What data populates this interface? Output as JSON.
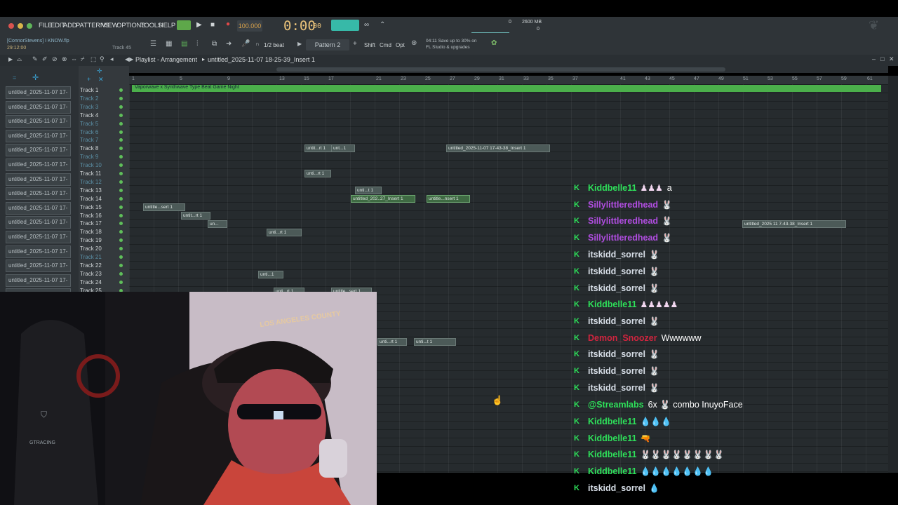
{
  "menu": [
    "FILE",
    "EDIT",
    "ADD",
    "PATTERNS",
    "VIEW",
    "OPTIONS",
    "TOOLS",
    "HELP"
  ],
  "transport": {
    "tempo": "100.000",
    "time": "0:00",
    "time_small": "00",
    "cpu_mem": "2600 MB",
    "cpu_a": "0",
    "cpu_b": "0"
  },
  "project": {
    "user": "[ConnorStevens] I KNOW.flp",
    "elapsed": "29:12:00",
    "track_label": "Track 45"
  },
  "toolbar": {
    "snap": "1/2 beat",
    "pattern": "Pattern 2",
    "shift": "Shift",
    "cmd": "Cmd",
    "opt": "Opt",
    "promo_line1": "04:11  Save up to 30% on",
    "promo_line2": "FL Studio & upgrades"
  },
  "playlist": {
    "title": "Playlist - Arrangement",
    "path": "untitled_2025-11-07 18-25-39_Insert 1"
  },
  "ruler": [
    "1",
    "5",
    "9",
    "13",
    "15",
    "17",
    "21",
    "23",
    "25",
    "27",
    "29",
    "31",
    "33",
    "35",
    "37",
    "41",
    "43",
    "45",
    "47",
    "49",
    "51",
    "53",
    "55",
    "57",
    "59",
    "61"
  ],
  "header_clip": "Vaporwave x Synthwave Type Beat Game Night",
  "browser_items": [
    "untitled_2025-11-07 17-",
    "untitled_2025-11-07 17-",
    "untitled_2025-11-07 17-",
    "untitled_2025-11-07 17-",
    "untitled_2025-11-07 17-",
    "untitled_2025-11-07 17-",
    "untitled_2025-11-07 17-",
    "untitled_2025-11-07 17-",
    "untitled_2025-11-07 17-",
    "untitled_2025-11-07 17-",
    "untitled_2025-11-07 17-",
    "untitled_2025-11-07 17-",
    "untitled_2025-11-07 17-",
    "untitled_2025-11-07 17-",
    "untitled_2025-11-07 17-"
  ],
  "tracks": [
    "Track 1",
    "Track 2",
    "Track 3",
    "Track 4",
    "Track 5",
    "Track 6",
    "Track 7",
    "Track 8",
    "Track 9",
    "Track 10",
    "Track 11",
    "Track 12",
    "Track 13",
    "Track 14",
    "Track 15",
    "Track 16",
    "Track 17",
    "Track 18",
    "Track 19",
    "Track 20",
    "Track 21",
    "Track 22",
    "Track 23",
    "Track 24",
    "Track 25"
  ],
  "clips": [
    {
      "label": "untit...rt 1"
    },
    {
      "label": "unt...1"
    },
    {
      "label": "untitled_2025-11-07 17-43-38_Insert 1"
    },
    {
      "label": "unti...rt 1"
    },
    {
      "label": "unti...t 1"
    },
    {
      "label": "untitled_202..27_Insert 1"
    },
    {
      "label": "untitle...nsert 1"
    },
    {
      "label": "untitle...sert 1"
    },
    {
      "label": "unti...rt 1"
    },
    {
      "label": "un..."
    },
    {
      "label": "unti...rt 1"
    },
    {
      "label": "unti...t 1"
    },
    {
      "label": "unti...1"
    },
    {
      "label": "untitle...sert 1"
    },
    {
      "label": "unti...rt 1"
    },
    {
      "label": "untit...rt 1"
    },
    {
      "label": "untitled_2025 11  7-43-38_Insert 1"
    }
  ],
  "chat": [
    {
      "user": "Kiddbelle11",
      "color": "#2ee05a",
      "msg": "a",
      "emotes": "♟♟♟"
    },
    {
      "user": "Sillylittleredhead",
      "color": "#b04de0",
      "msg": "",
      "emotes": "🐰"
    },
    {
      "user": "Sillylittleredhead",
      "color": "#b04de0",
      "msg": "",
      "emotes": "🐰"
    },
    {
      "user": "Sillylittleredhead",
      "color": "#b04de0",
      "msg": "",
      "emotes": "🐰"
    },
    {
      "user": "itskidd_sorrel",
      "color": "#d6dde6",
      "msg": "",
      "emotes": "🐰"
    },
    {
      "user": "itskidd_sorrel",
      "color": "#d6dde6",
      "msg": "",
      "emotes": "🐰"
    },
    {
      "user": "itskidd_sorrel",
      "color": "#d6dde6",
      "msg": "",
      "emotes": "🐰"
    },
    {
      "user": "Kiddbelle11",
      "color": "#2ee05a",
      "msg": "",
      "emotes": "♟♟♟♟♟"
    },
    {
      "user": "itskidd_sorrel",
      "color": "#d6dde6",
      "msg": "",
      "emotes": "🐰"
    },
    {
      "user": "Demon_Snoozer",
      "color": "#d0253f",
      "msg": "Wwwwww",
      "emotes": ""
    },
    {
      "user": "itskidd_sorrel",
      "color": "#d6dde6",
      "msg": "",
      "emotes": "🐰"
    },
    {
      "user": "itskidd_sorrel",
      "color": "#d6dde6",
      "msg": "",
      "emotes": "🐰"
    },
    {
      "user": "itskidd_sorrel",
      "color": "#d6dde6",
      "msg": "",
      "emotes": "🐰"
    },
    {
      "user": "@Streamlabs",
      "color": "#2ee05a",
      "msg": "6x 🐰 combo InuyoFace",
      "emotes": ""
    },
    {
      "user": "Kiddbelle11",
      "color": "#2ee05a",
      "msg": "",
      "emotes": "💧💧💧"
    },
    {
      "user": "Kiddbelle11",
      "color": "#2ee05a",
      "msg": "",
      "emotes": "🔫"
    },
    {
      "user": "Kiddbelle11",
      "color": "#2ee05a",
      "msg": "",
      "emotes": "🐰🐰🐰🐰🐰🐰🐰🐰"
    },
    {
      "user": "Kiddbelle11",
      "color": "#2ee05a",
      "msg": "",
      "emotes": "💧💧💧💧💧💧💧"
    },
    {
      "user": "itskidd_sorrel",
      "color": "#d6dde6",
      "msg": "",
      "emotes": "💧"
    }
  ],
  "webcam": {
    "hat_text": "LOS ANGELES COUNTY",
    "chair_text": "GTRACING"
  }
}
